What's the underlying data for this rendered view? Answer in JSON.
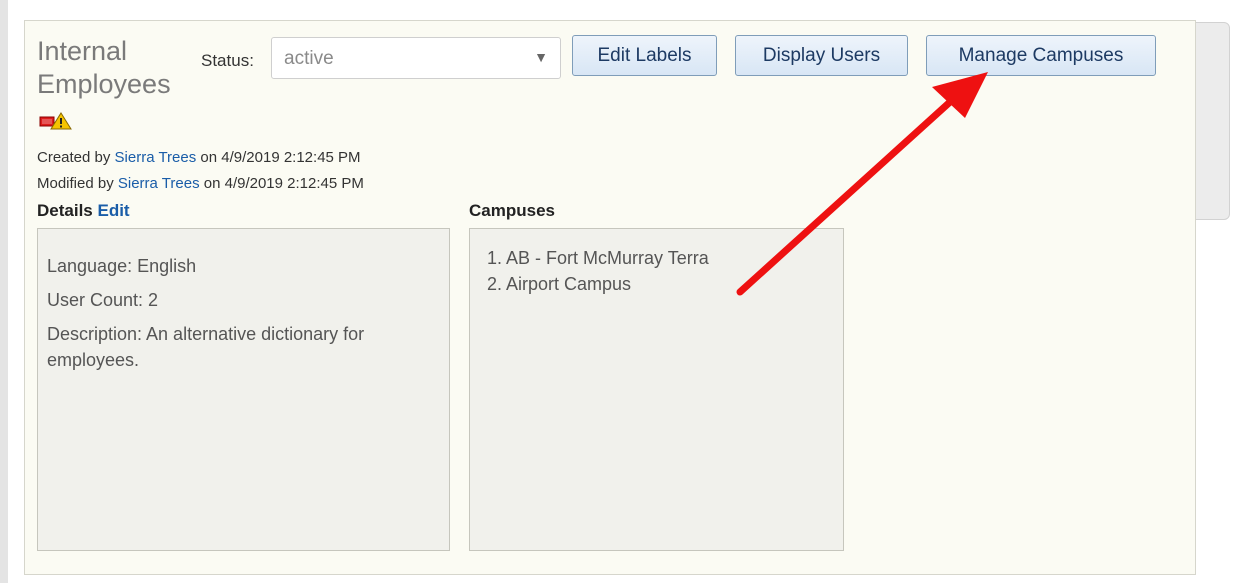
{
  "group": {
    "title": "Internal Employees",
    "status_label": "Status:",
    "status_value": "active"
  },
  "toolbar": {
    "edit_labels": "Edit Labels",
    "display_users": "Display Users",
    "manage_campuses": "Manage Campuses"
  },
  "meta": {
    "created_prefix": "Created by ",
    "created_user": "Sierra Trees",
    "created_suffix": " on 4/9/2019 2:12:45 PM",
    "modified_prefix": "Modified by ",
    "modified_user": "Sierra Trees",
    "modified_suffix": " on 4/9/2019 2:12:45 PM"
  },
  "details": {
    "heading": "Details",
    "edit_link": "Edit",
    "language": "Language: English",
    "user_count": "User Count: 2",
    "description": "Description: An alternative dictionary for employees."
  },
  "campuses": {
    "heading": "Campuses",
    "items": [
      "1. AB - Fort McMurray Terra",
      "2. Airport Campus"
    ]
  },
  "colors": {
    "annotation_arrow": "#ee1111",
    "link": "#1a5da8",
    "panel_background": "#fbfbf3"
  },
  "icons": {
    "status_warning": "warning-icon",
    "dropdown": "chevron-down-icon"
  }
}
